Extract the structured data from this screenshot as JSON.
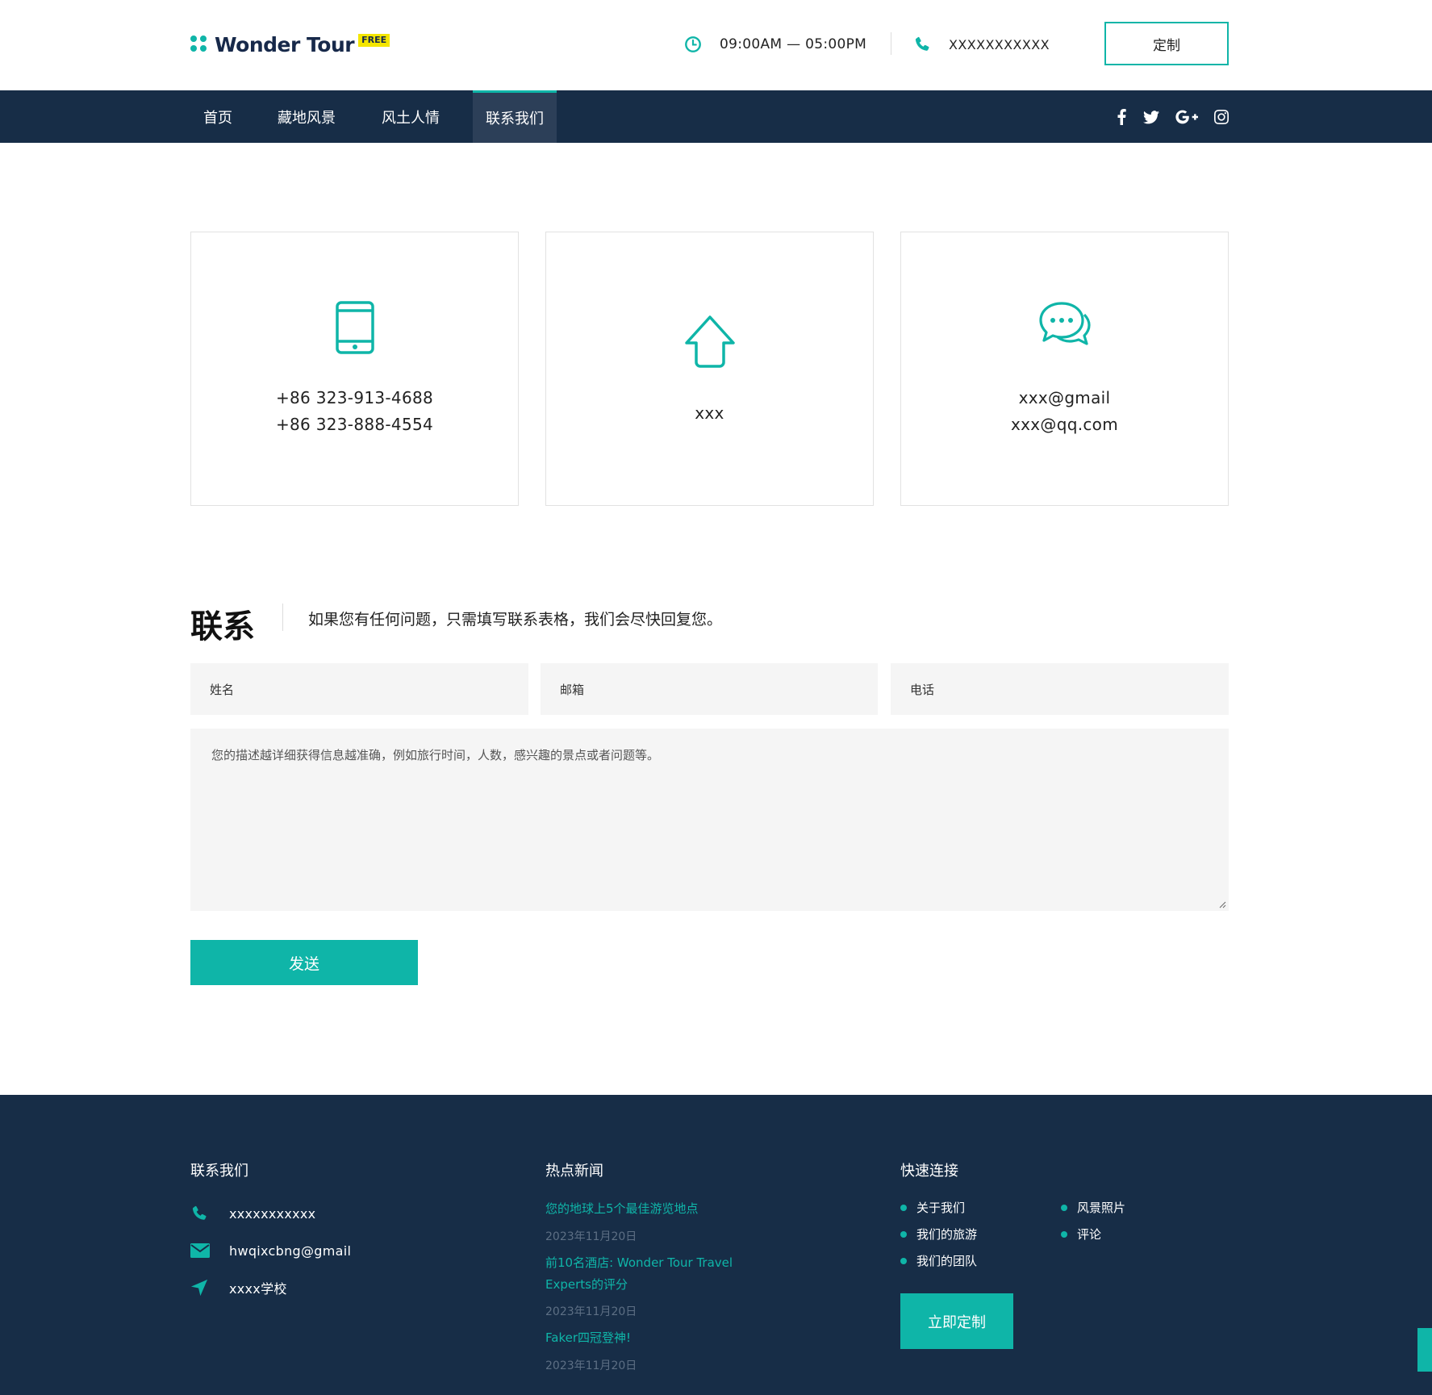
{
  "colors": {
    "accent": "#0fb5a8",
    "navy": "#172d47",
    "field_bg": "#f5f5f5"
  },
  "header": {
    "logo_text": "Wonder Tour",
    "logo_badge": "FREE",
    "hours": "09:00AM — 05:00PM",
    "phone": "XXXXXXXXXXX",
    "custom_button": "定制"
  },
  "nav": {
    "items": [
      "首页",
      "藏地风景",
      "风土人情",
      "联系我们"
    ],
    "active_index": 3,
    "social": [
      "facebook-icon",
      "twitter-icon",
      "google-plus-icon",
      "instagram-icon"
    ]
  },
  "cards": {
    "phone": {
      "icon": "tablet-icon",
      "line1": "+86 323-913-4688",
      "line2": "+86 323-888-4554"
    },
    "address": {
      "icon": "home-icon",
      "line1": "xxx"
    },
    "email": {
      "icon": "chat-icon",
      "line1": "xxx@gmail",
      "line2": "xxx@qq.com"
    }
  },
  "form": {
    "title": "联系",
    "description": "如果您有任何问题，只需填写联系表格，我们会尽快回复您。",
    "name_placeholder": "姓名",
    "email_placeholder": "邮箱",
    "phone_placeholder": "电话",
    "message_placeholder": "您的描述越详细获得信息越准确，例如旅行时间，人数，感兴趣的景点或者问题等。",
    "send_button": "发送"
  },
  "footer": {
    "contact": {
      "title": "联系我们",
      "phone": "xxxxxxxxxxx",
      "email": "hwqixcbng@gmail",
      "address": "xxxx学校"
    },
    "news": {
      "title": "热点新闻",
      "items": [
        {
          "title": "您的地球上5个最佳游览地点",
          "date": "2023年11月20日"
        },
        {
          "title_line1": "前10名酒店: Wonder Tour Travel",
          "title_line2": "Experts的评分",
          "date": "2023年11月20日"
        },
        {
          "title": "Faker四冠登神!",
          "date": "2023年11月20日"
        }
      ]
    },
    "links": {
      "title": "快速连接",
      "col1": [
        "关于我们",
        "我们的旅游",
        "我们的团队"
      ],
      "col2": [
        "风景照片",
        "评论"
      ],
      "cta_button": "立即定制"
    }
  }
}
